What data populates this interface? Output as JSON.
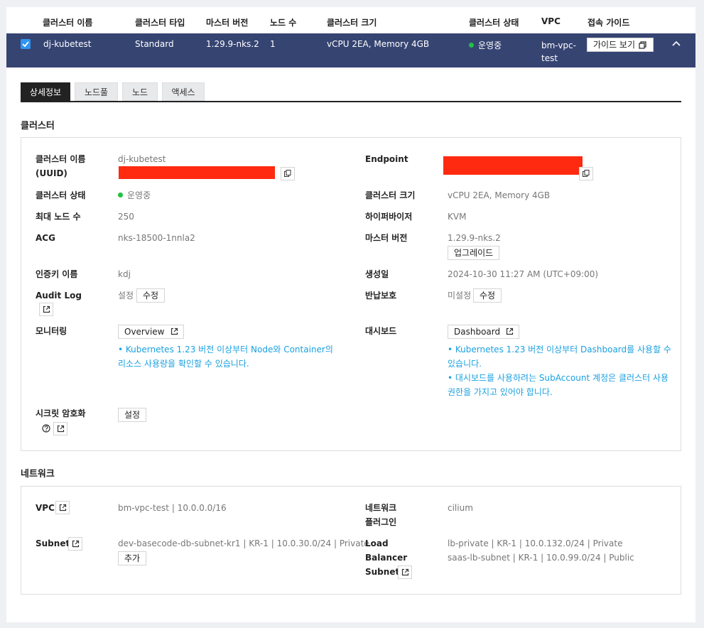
{
  "table": {
    "headers": [
      "클러스터 이름",
      "클러스터 타입",
      "마스터 버전",
      "노드 수",
      "클러스터 크기",
      "클러스터 상태",
      "VPC",
      "접속 가이드"
    ],
    "row": {
      "name": "dj-kubetest",
      "type": "Standard",
      "master_version": "1.29.9-nks.2",
      "node_count": "1",
      "size": "vCPU 2EA, Memory 4GB",
      "status": "운영중",
      "vpc_line1": "bm-vpc-",
      "vpc_line2": "test",
      "guide_button": "가이드 보기"
    }
  },
  "tabs": [
    "상세정보",
    "노드풀",
    "노드",
    "액세스"
  ],
  "cluster_section": {
    "title": "클러스터",
    "name_label_1": "클러스터 이름",
    "name_label_2": "(UUID)",
    "name_value": "dj-kubetest",
    "endpoint_label": "Endpoint",
    "status_label": "클러스터 상태",
    "status_value": "운영중",
    "size_label": "클러스터 크기",
    "size_value": "vCPU 2EA, Memory 4GB",
    "max_nodes_label": "최대 노드 수",
    "max_nodes_value": "250",
    "hypervisor_label": "하이퍼바이저",
    "hypervisor_value": "KVM",
    "acg_label": "ACG",
    "acg_value": "nks-18500-1nnla2",
    "master_version_label": "마스터 버전",
    "master_version_value": "1.29.9-nks.2",
    "upgrade_button": "업그레이드",
    "auth_key_label": "인증키 이름",
    "auth_key_value": "kdj",
    "created_label": "생성일",
    "created_value": "2024-10-30 11:27 AM (UTC+09:00)",
    "audit_label": "Audit Log",
    "audit_value": "설정",
    "audit_edit": "수정",
    "return_protect_label": "반납보호",
    "return_protect_value": "미설정",
    "return_protect_edit": "수정",
    "monitoring_label": "모니터링",
    "overview_button": "Overview",
    "monitoring_note_1": "• Kubernetes 1.23 버전 이상부터 Node와 Container의",
    "monitoring_note_2": "리소스 사용량을 확인할 수 있습니다.",
    "dashboard_label": "대시보드",
    "dashboard_button": "Dashboard",
    "dashboard_note_1": "• Kubernetes 1.23 버전 이상부터 Dashboard를 사용할 수",
    "dashboard_note_2": "있습니다.",
    "dashboard_note_3": "• 대시보드를 사용하려는 SubAccount 계정은 클러스터 사용",
    "dashboard_note_4": "권한을 가지고 있어야 합니다.",
    "secret_label": "시크릿 암호화",
    "secret_button": "설정"
  },
  "network_section": {
    "title": "네트워크",
    "vpc_label": "VPC",
    "vpc_value": "bm-vpc-test | 10.0.0.0/16",
    "plugin_label_1": "네트워크",
    "plugin_label_2": "플러그인",
    "plugin_value": "cilium",
    "subnet_label": "Subnet",
    "subnet_value": "dev-basecode-db-subnet-kr1 | KR-1 | 10.0.30.0/24 | Private",
    "subnet_add": "추가",
    "lb_label_1": "Load",
    "lb_label_2": "Balancer",
    "lb_label_3": "Subnet",
    "lb_value_1": "lb-private | KR-1 | 10.0.132.0/24 | Private",
    "lb_value_2": "saas-lb-subnet | KR-1 | 10.0.99.0/24 | Public"
  },
  "colors": {
    "header_row": "#364472",
    "status_green": "#1fc241",
    "note_blue": "#1aa0e0",
    "redaction": "#ff2a10"
  }
}
